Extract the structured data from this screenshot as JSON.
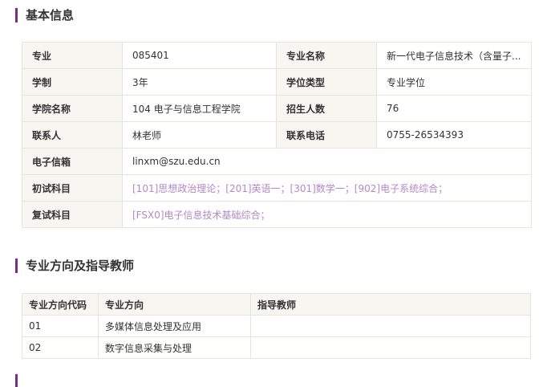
{
  "basic_info": {
    "title": "基本信息",
    "rows": [
      [
        {
          "label": "专业",
          "value": "085401"
        },
        {
          "label": "专业名称",
          "value": "新一代电子信息技术（含量子..."
        }
      ],
      [
        {
          "label": "学制",
          "value": "3年"
        },
        {
          "label": "学位类型",
          "value": "专业学位"
        }
      ],
      [
        {
          "label": "学院名称",
          "value": "104 电子与信息工程学院"
        },
        {
          "label": "招生人数",
          "value": "76"
        }
      ],
      [
        {
          "label": "联系人",
          "value": "林老师"
        },
        {
          "label": "联系电话",
          "value": "0755-26534393"
        }
      ]
    ],
    "email": {
      "label": "电子信箱",
      "value": "linxm@szu.edu.cn"
    },
    "initial_subjects": {
      "label": "初试科目",
      "value": "[101]思想政治理论；[201]英语一；[301]数学一；[902]电子系统综合；"
    },
    "retest_subjects": {
      "label": "复试科目",
      "value": "[FSX0]电子信息技术基础综合；"
    }
  },
  "directions": {
    "title": "专业方向及指导教师",
    "headers": [
      "专业方向代码",
      "专业方向",
      "指导教师"
    ],
    "rows": [
      [
        "01",
        "多媒体信息处理及应用",
        ""
      ],
      [
        "02",
        "数字信息采集与处理",
        ""
      ]
    ]
  },
  "colors": {
    "accent": "#7b2c8b",
    "link": "#b487c7",
    "label_bg": "#f8f6f1",
    "border": "#e9e3da"
  }
}
